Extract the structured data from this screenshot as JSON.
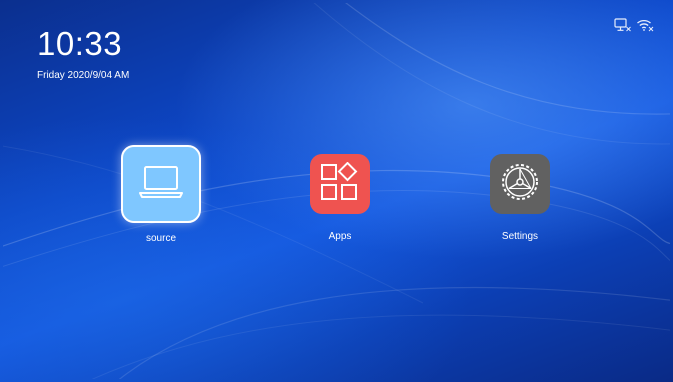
{
  "status": {
    "clock": "10:33",
    "date": "Friday 2020/9/04 AM",
    "icons": [
      "screen-disconnected-icon",
      "wifi-disconnected-icon"
    ]
  },
  "apps": [
    {
      "label": "source",
      "icon": "laptop-icon",
      "color": "#7fc7ff",
      "selected": true
    },
    {
      "label": "Apps",
      "icon": "apps-grid-icon",
      "color": "#ef5350",
      "selected": false
    },
    {
      "label": "Settings",
      "icon": "gear-icon",
      "color": "#616161",
      "selected": false
    }
  ]
}
